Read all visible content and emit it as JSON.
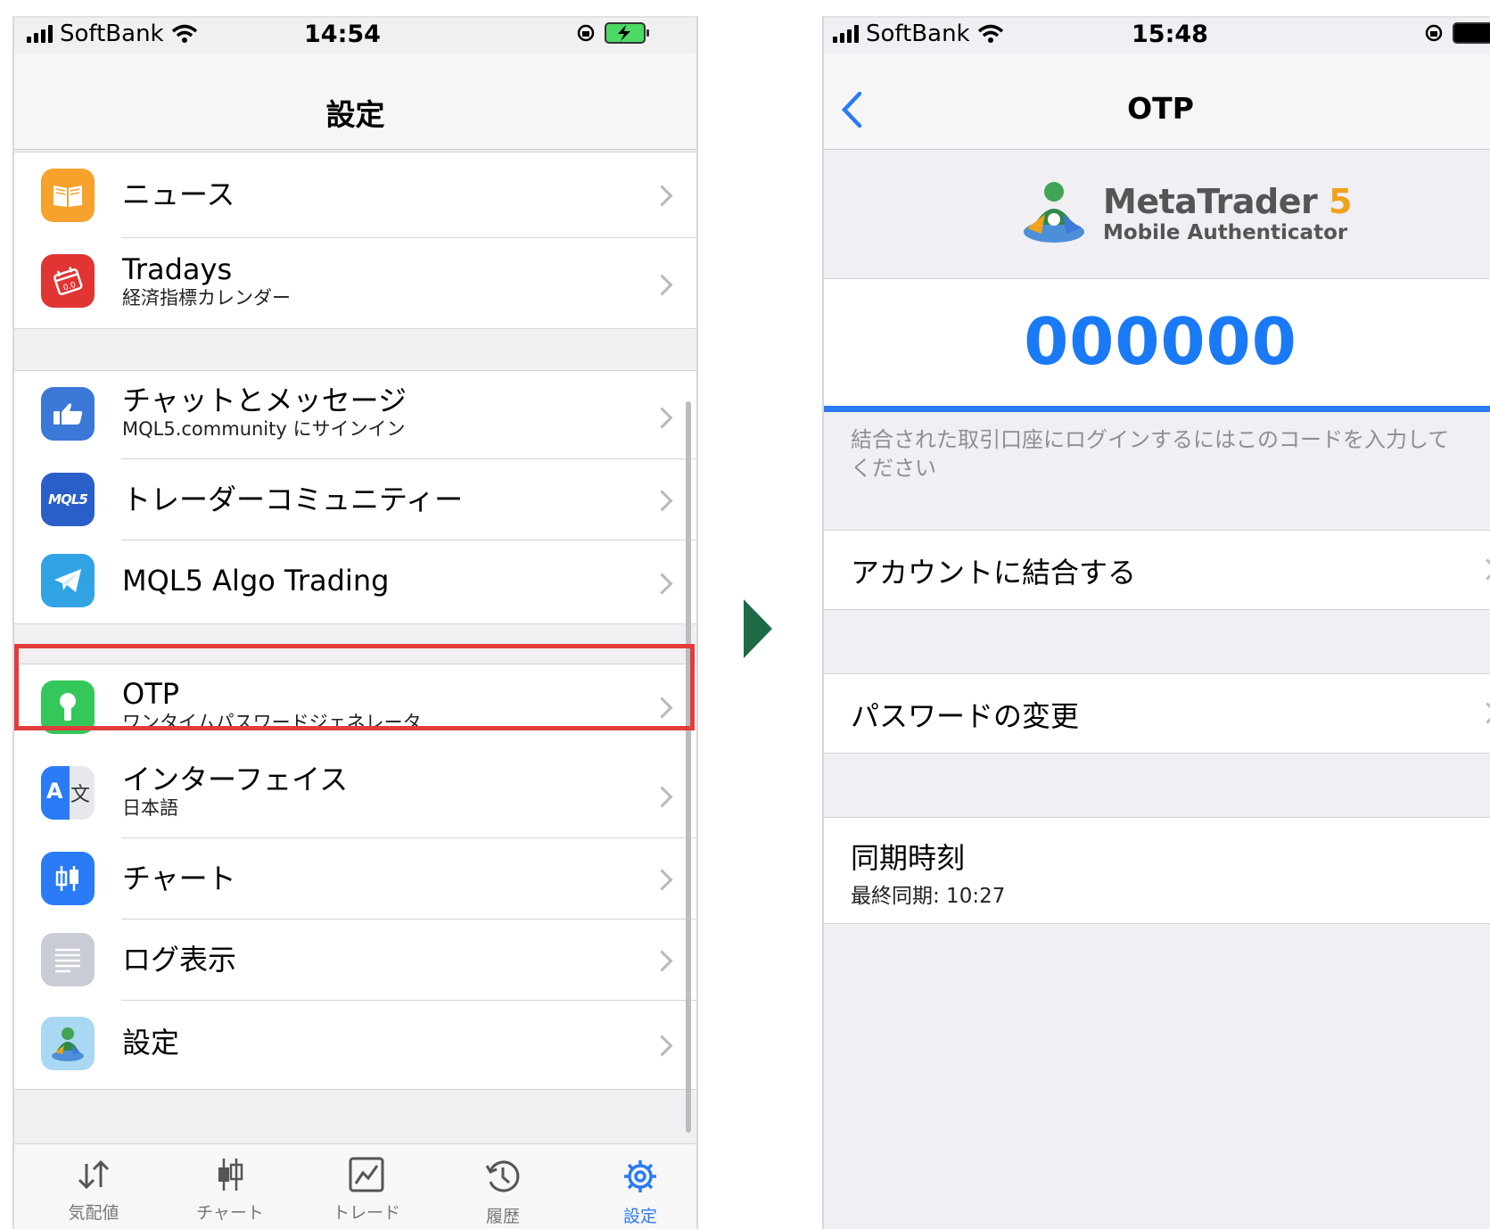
{
  "left": {
    "status": {
      "carrier": "SoftBank",
      "time": "14:54"
    },
    "title": "設定",
    "items": [
      {
        "label": "ニュース",
        "sub": ""
      },
      {
        "label": "Tradays",
        "sub": "経済指標カレンダー"
      },
      {
        "label": "チャットとメッセージ",
        "sub": "MQL5.community にサインイン"
      },
      {
        "label": "トレーダーコミュニティー",
        "sub": ""
      },
      {
        "label": "MQL5 Algo Trading",
        "sub": ""
      },
      {
        "label": "OTP",
        "sub": "ワンタイムパスワードジェネレータ"
      },
      {
        "label": "インターフェイス",
        "sub": "日本語"
      },
      {
        "label": "チャート",
        "sub": ""
      },
      {
        "label": "ログ表示",
        "sub": ""
      },
      {
        "label": "設定",
        "sub": ""
      }
    ],
    "mql5_badge": "MQL5",
    "tabs": [
      "気配値",
      "チャート",
      "トレード",
      "履歴",
      "設定"
    ],
    "active_tab": "設定"
  },
  "right": {
    "status": {
      "carrier": "SoftBank",
      "time": "15:48"
    },
    "title": "OTP",
    "logo_name": "MetaTrader",
    "logo_version": "5",
    "logo_sub": "Mobile Authenticator",
    "code": "000000",
    "progress": 1.0,
    "hint": "結合された取引口座にログインするにはこのコードを入力してください",
    "bind_account": "アカウントに結合する",
    "change_password": "パスワードの変更",
    "sync_label": "同期時刻",
    "sync_value": "最終同期: 10:27"
  },
  "colors": {
    "accent": "#2a7bf5",
    "highlight": "#e23c3c",
    "arrow": "#1e6a46"
  },
  "icons": [
    "news-icon",
    "tradays-icon",
    "chat-icon",
    "mql5-icon",
    "telegram-icon",
    "otp-lock-icon",
    "translate-icon",
    "chart-icon",
    "log-icon",
    "metatrader-icon"
  ]
}
